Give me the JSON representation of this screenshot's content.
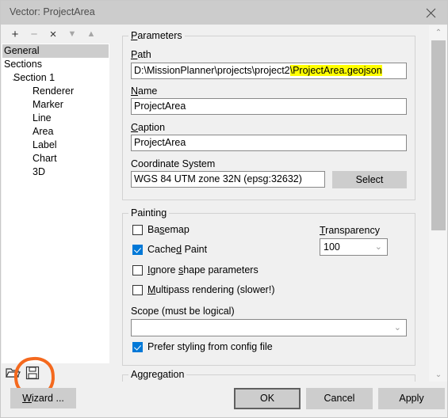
{
  "window": {
    "title": "Vector: ProjectArea",
    "close_icon": "close-icon"
  },
  "tree_toolbar": {
    "add": "+",
    "remove": "−",
    "delete": "×",
    "move_down": "▼",
    "move_up": "▲"
  },
  "tree": {
    "items": [
      {
        "label": "General",
        "indent": 0,
        "selected": true,
        "chevron": ""
      },
      {
        "label": "Sections",
        "indent": 0,
        "selected": false,
        "chevron": ""
      },
      {
        "label": "Section 1",
        "indent": 1,
        "selected": false,
        "chevron": "⌄"
      },
      {
        "label": "Renderer",
        "indent": 2,
        "selected": false,
        "chevron": ""
      },
      {
        "label": "Marker",
        "indent": 2,
        "selected": false,
        "chevron": ""
      },
      {
        "label": "Line",
        "indent": 2,
        "selected": false,
        "chevron": ""
      },
      {
        "label": "Area",
        "indent": 2,
        "selected": false,
        "chevron": ""
      },
      {
        "label": "Label",
        "indent": 2,
        "selected": false,
        "chevron": ""
      },
      {
        "label": "Chart",
        "indent": 2,
        "selected": false,
        "chevron": ""
      },
      {
        "label": "3D",
        "indent": 2,
        "selected": false,
        "chevron": ""
      }
    ]
  },
  "file_actions": {
    "open_icon": "folder-open-icon",
    "save_icon": "save-floppy-icon",
    "wizard_label": "Wizard ...",
    "annotation_color": "#f4691e"
  },
  "parameters": {
    "group_title": "Parameters",
    "path_label": "Path",
    "path_prefix": "D:\\MissionPlanner\\projects\\project2",
    "path_highlight": "\\ProjectArea.geojson",
    "name_label": "Name",
    "name_value": "ProjectArea",
    "caption_label": "Caption",
    "caption_value": "ProjectArea",
    "crs_label": "Coordinate System",
    "crs_value": "WGS 84 UTM zone 32N (epsg:32632)",
    "select_button": "Select"
  },
  "painting": {
    "group_title": "Painting",
    "checkboxes": [
      {
        "label": "Basemap",
        "checked": false
      },
      {
        "label": "Cached Paint",
        "checked": true
      },
      {
        "label": "Ignore shape parameters",
        "checked": false
      },
      {
        "label": "Multipass rendering (slower!)",
        "checked": false
      }
    ],
    "transparency_label": "Transparency",
    "transparency_value": "100",
    "scope_label": "Scope (must be logical)",
    "scope_value": "",
    "prefer_styling_label": "Prefer styling from config file",
    "prefer_styling_checked": true
  },
  "aggregation": {
    "group_title": "Aggregation"
  },
  "scrollbar": {
    "up_icon": "chevron-up-icon",
    "down_icon": "chevron-down-icon"
  },
  "footer": {
    "ok": "OK",
    "cancel": "Cancel",
    "apply": "Apply"
  },
  "colors": {
    "accent": "#0078d7",
    "highlight": "#ffff00",
    "annotation": "#f4691e",
    "window_bg": "#f0f0f0",
    "titlebar": "#cccccc"
  }
}
